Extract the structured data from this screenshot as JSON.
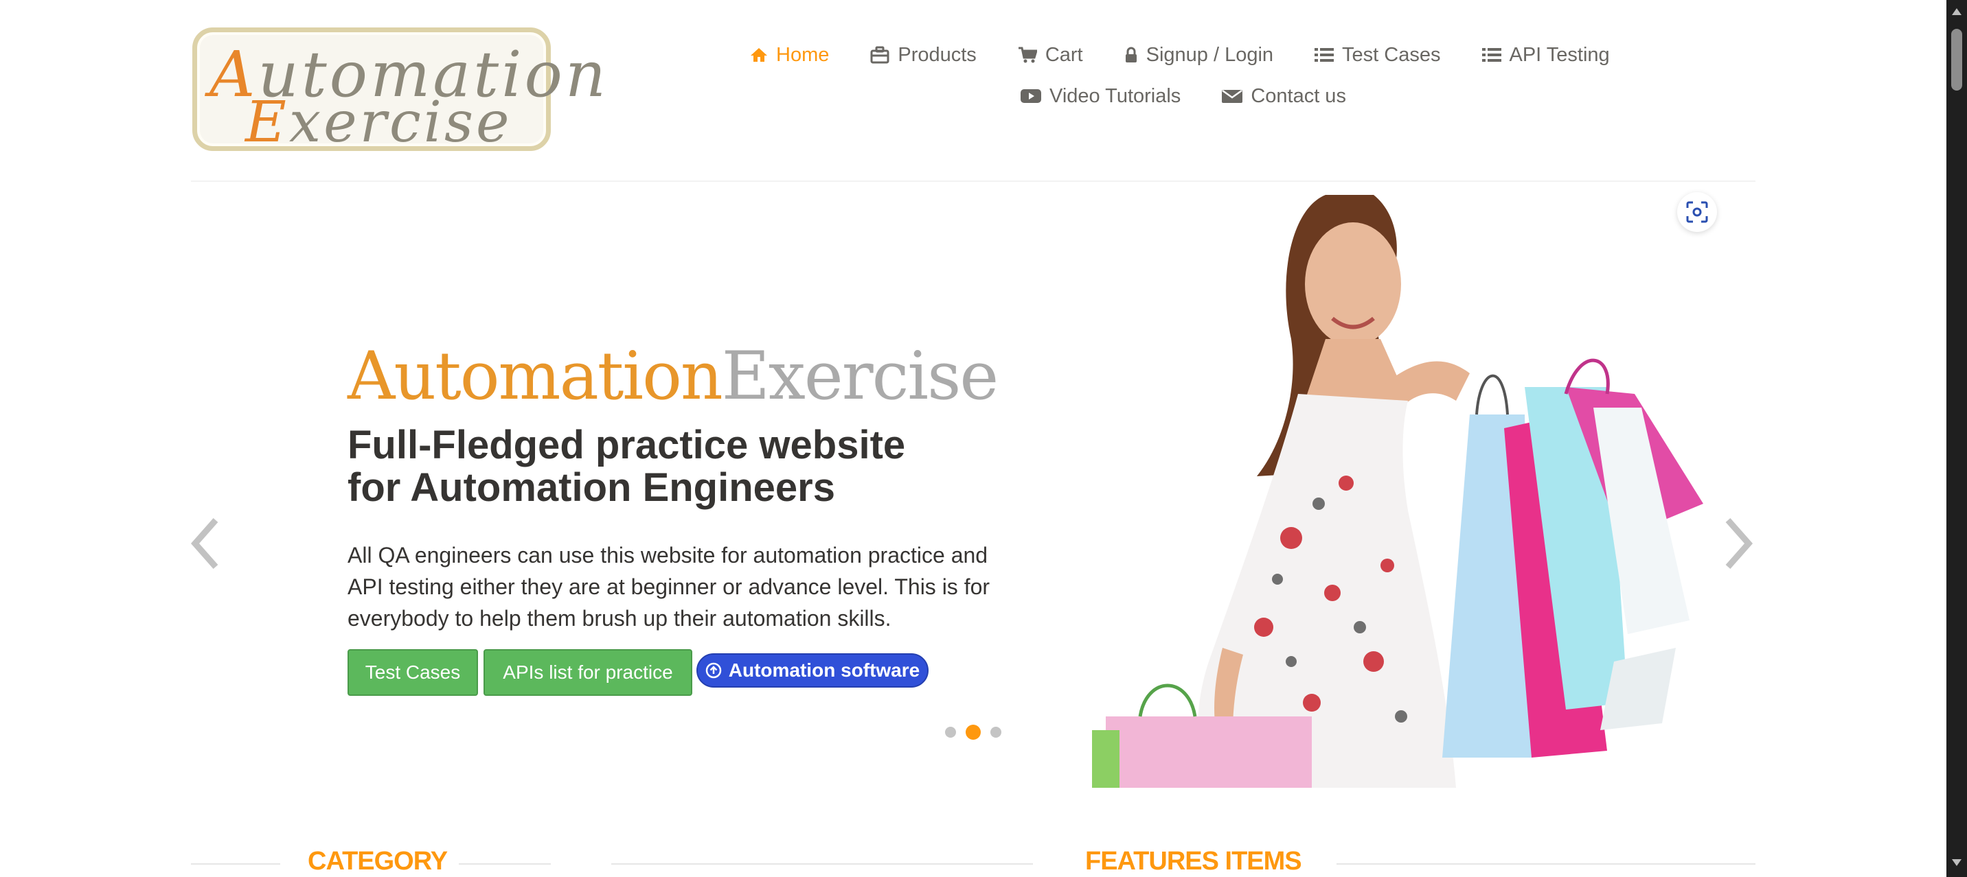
{
  "logo": {
    "line1_cap": "A",
    "line1_rest": "utomation",
    "line2_cap": "E",
    "line2_rest": "xercise"
  },
  "nav": {
    "home": "Home",
    "products": "Products",
    "cart": "Cart",
    "signup_login": "Signup / Login",
    "test_cases": "Test Cases",
    "api_testing": "API Testing",
    "video_tutorials": "Video Tutorials",
    "contact_us": "Contact us"
  },
  "slider": {
    "brand_part1": "Automation",
    "brand_part2": "Exercise",
    "headline": "Full-Fledged practice website for Automation Engineers",
    "description": "All QA engineers can use this website for automation practice and API testing either they are at beginner or advance level. This is for everybody to help them brush up their automation skills.",
    "buttons": {
      "test_cases": "Test Cases",
      "apis_list": "APIs list for practice",
      "automation_software": "Automation software"
    },
    "active_slide": 2,
    "slide_count": 3
  },
  "sections": {
    "category": "CATEGORY",
    "features_items": "FEATURES ITEMS"
  },
  "colors": {
    "accent": "#fe980f",
    "button_green": "#5cb85c",
    "button_blue": "#3050d8",
    "text_dark": "#363432",
    "text_muted": "#696763"
  },
  "icons": [
    "home-icon",
    "briefcase-icon",
    "cart-icon",
    "lock-icon",
    "list-icon",
    "youtube-icon",
    "envelope-icon",
    "chevron-left-icon",
    "chevron-right-icon",
    "visual-search-icon",
    "arrow-circle-icon"
  ]
}
